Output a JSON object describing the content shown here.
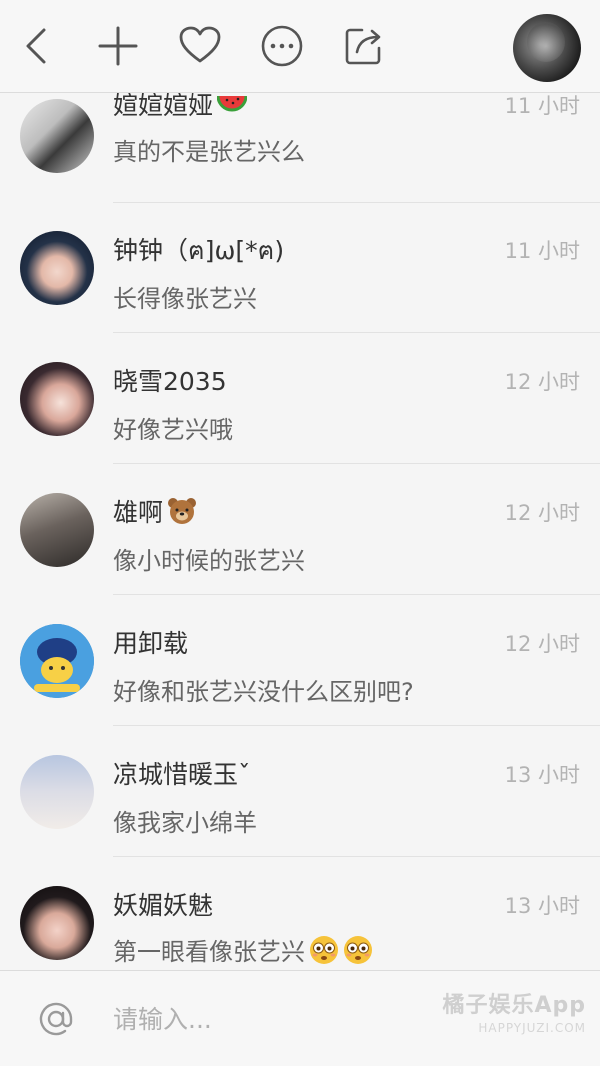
{
  "toolbar": {
    "back_icon": "chevron-left-icon",
    "add_icon": "plus-icon",
    "like_icon": "heart-icon",
    "more_icon": "ellipsis-circle-icon",
    "share_icon": "share-icon"
  },
  "comments": [
    {
      "name": "媗媗媗娅",
      "emoji": "watermelon",
      "time": "11 小时",
      "text": "真的不是张艺兴么"
    },
    {
      "name": "钟钟（ฅ]ω[*ฅ)",
      "emoji": "",
      "time": "11 小时",
      "text": "长得像张艺兴"
    },
    {
      "name": "晓雪2035",
      "emoji": "",
      "time": "12 小时",
      "text": "好像艺兴哦"
    },
    {
      "name": "雄啊",
      "emoji": "bear",
      "time": "12 小时",
      "text": "像小时候的张艺兴"
    },
    {
      "name": "用卸载",
      "emoji": "",
      "time": "12 小时",
      "text": "好像和张艺兴没什么区别吧?"
    },
    {
      "name": "凉城惜暖玉ˇ",
      "emoji": "",
      "time": "13 小时",
      "text": "像我家小绵羊"
    },
    {
      "name": "妖媚妖魅",
      "emoji": "",
      "time": "13 小时",
      "text": "第一眼看像张艺兴",
      "text_emoji": "flushed-face ×2"
    }
  ],
  "input": {
    "at_icon": "at-icon",
    "placeholder": "请输入..."
  },
  "watermark": {
    "main": "橘子娱乐App",
    "sub": "HAPPYJUZI.COM"
  }
}
